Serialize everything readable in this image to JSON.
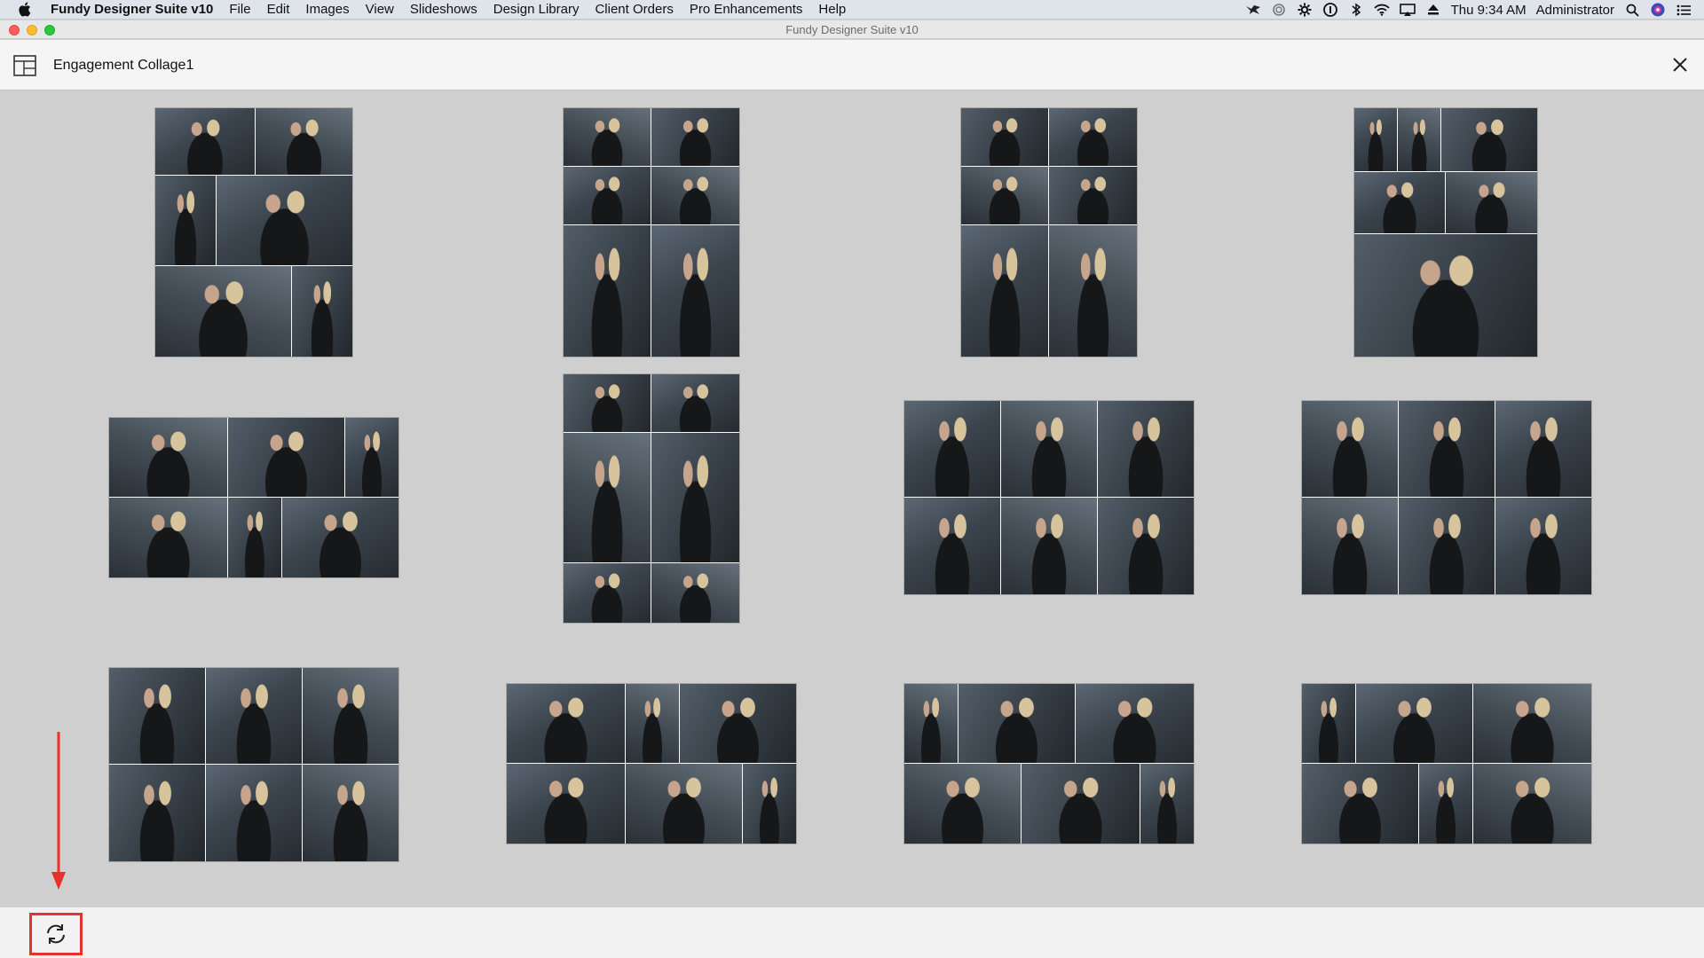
{
  "menubar": {
    "app_name": "Fundy Designer Suite v10",
    "items": [
      "File",
      "Edit",
      "Images",
      "View",
      "Slideshows",
      "Design Library",
      "Client Orders",
      "Pro Enhancements",
      "Help"
    ],
    "clock": "Thu 9:34 AM",
    "user": "Administrator"
  },
  "window": {
    "title": "Fundy Designer Suite v10"
  },
  "header": {
    "document_title": "Engagement Collage1"
  },
  "colors": {
    "highlight": "#e8312a",
    "background": "#cfcfcf"
  },
  "collages": [
    {
      "id": 1
    },
    {
      "id": 2
    },
    {
      "id": 3
    },
    {
      "id": 4
    },
    {
      "id": 5
    },
    {
      "id": 6
    },
    {
      "id": 7
    },
    {
      "id": 8
    },
    {
      "id": 9
    },
    {
      "id": 10
    },
    {
      "id": 11
    },
    {
      "id": 12
    }
  ],
  "bottombar": {
    "refresh_icon": "refresh-icon"
  }
}
